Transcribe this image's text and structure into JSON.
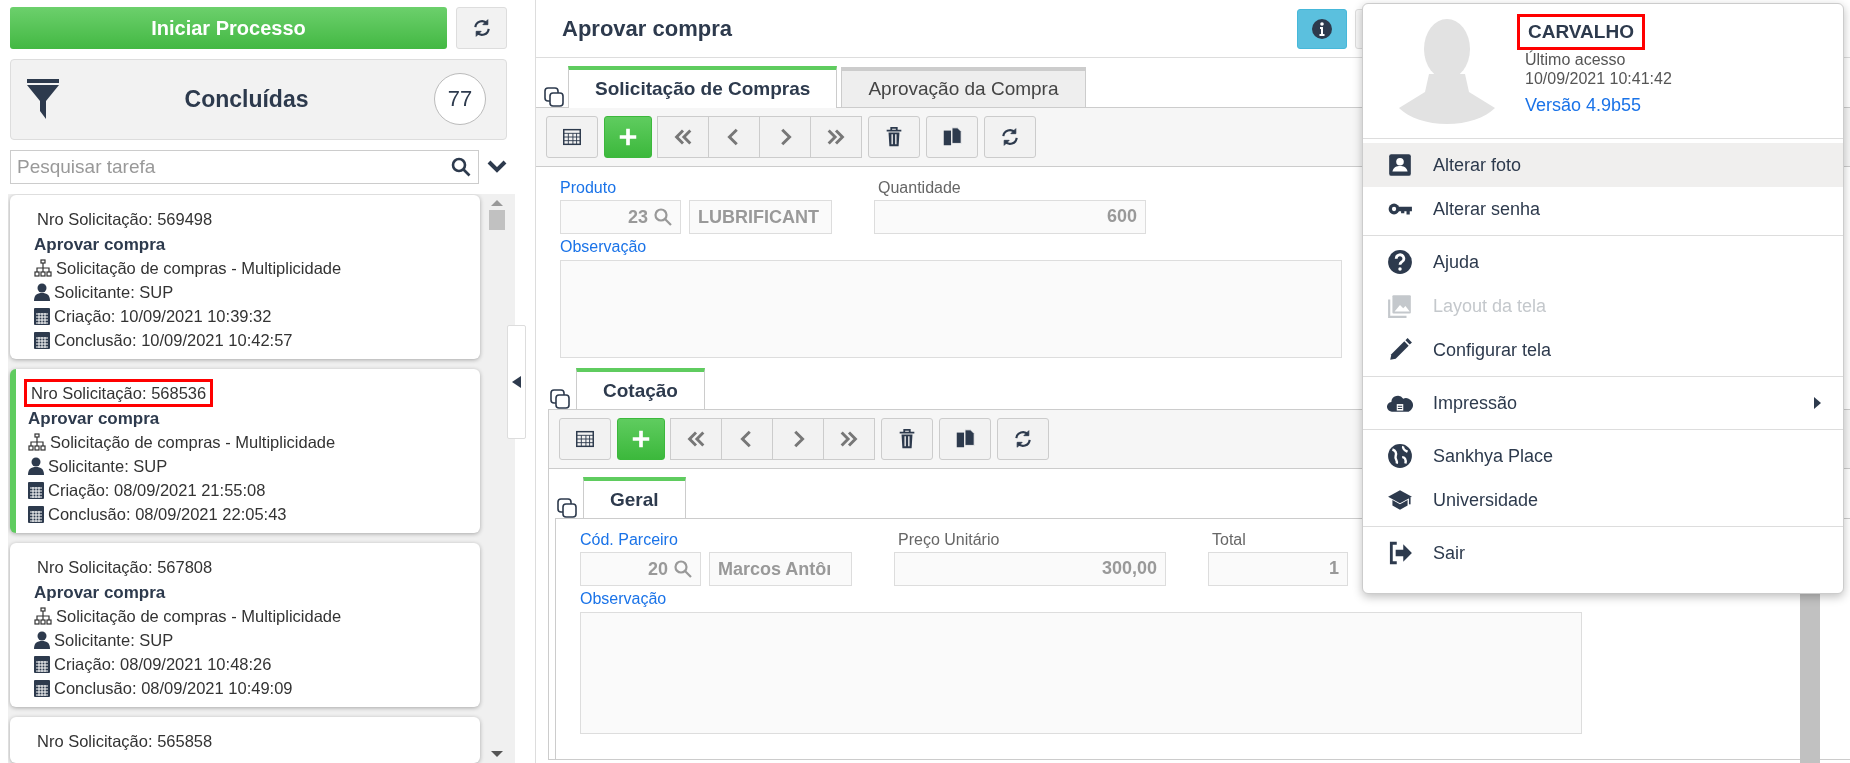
{
  "sidebar": {
    "start_button": "Iniciar Processo",
    "filter": {
      "label": "Concluídas",
      "count": "77"
    },
    "search": {
      "placeholder": "Pesquisar tarefa"
    },
    "tasks": [
      {
        "number": "Nro Solicitação: 569498",
        "title": "Aprovar compra",
        "process": "Solicitação de compras - Multiplicidade",
        "requester": "Solicitante:  SUP",
        "created": "Criação: 10/09/2021 10:39:32",
        "completed": "Conclusão: 10/09/2021 10:42:57",
        "selected": false,
        "highlighted": false
      },
      {
        "number": "Nro Solicitação: 568536",
        "title": "Aprovar compra",
        "process": "Solicitação de compras - Multiplicidade",
        "requester": "Solicitante:  SUP",
        "created": "Criação: 08/09/2021 21:55:08",
        "completed": "Conclusão: 08/09/2021 22:05:43",
        "selected": true,
        "highlighted": true
      },
      {
        "number": "Nro Solicitação: 567808",
        "title": "Aprovar compra",
        "process": "Solicitação de compras - Multiplicidade",
        "requester": "Solicitante:  SUP",
        "created": "Criação: 08/09/2021 10:48:26",
        "completed": "Conclusão: 08/09/2021 10:49:09",
        "selected": false,
        "highlighted": false
      },
      {
        "number": "Nro Solicitação: 565858",
        "selected": false,
        "highlighted": false
      }
    ]
  },
  "main": {
    "title": "Aprovar compra",
    "tabs": [
      {
        "label": "Solicitação de Compras",
        "selected": true
      },
      {
        "label": "Aprovação da Compra",
        "selected": false
      }
    ],
    "fields": [
      {
        "kind": "lookup",
        "label": "Produto",
        "required": true,
        "code": "23",
        "value": "LUBRIFICANT"
      },
      {
        "kind": "number",
        "label": "Quantidade",
        "required": false,
        "value": "600"
      }
    ],
    "notes_label": "Observação",
    "detail": {
      "tabs": [
        {
          "label": "Cotação",
          "selected": true
        }
      ],
      "inner_tabs": [
        {
          "label": "Geral",
          "selected": true
        }
      ],
      "fields": [
        {
          "kind": "lookup",
          "label": "Cód. Parceiro",
          "required": true,
          "code": "20",
          "value": "Marcos Antôı"
        },
        {
          "kind": "number",
          "label": "Preço Unitário",
          "required": false,
          "value": "300,00"
        },
        {
          "kind": "number",
          "label": "Total",
          "required": false,
          "value": "1"
        }
      ],
      "notes_label": "Observação"
    }
  },
  "user_menu": {
    "name": "CARVALHO",
    "name_highlighted": true,
    "last_access_label": "Último acesso",
    "last_access": "10/09/2021 10:41:42",
    "version": "Versão 4.9b55",
    "groups": [
      [
        {
          "kind": "portrait",
          "label": "Alterar foto",
          "selected": true,
          "disabled": false,
          "submenu": false
        },
        {
          "kind": "key",
          "label": "Alterar senha",
          "selected": false,
          "disabled": false,
          "submenu": false
        }
      ],
      [
        {
          "kind": "help",
          "label": "Ajuda",
          "selected": false,
          "disabled": false,
          "submenu": false
        },
        {
          "kind": "images",
          "label": "Layout da tela",
          "selected": false,
          "disabled": true,
          "submenu": false
        },
        {
          "kind": "pencil",
          "label": "Configurar tela",
          "selected": false,
          "disabled": false,
          "submenu": false
        }
      ],
      [
        {
          "kind": "cloud",
          "label": "Impressão",
          "selected": false,
          "disabled": false,
          "submenu": true
        }
      ],
      [
        {
          "kind": "globe",
          "label": "Sankhya Place",
          "selected": false,
          "disabled": false,
          "submenu": false
        },
        {
          "kind": "cap",
          "label": "Universidade",
          "selected": false,
          "disabled": false,
          "submenu": false
        }
      ],
      [
        {
          "kind": "exit",
          "label": "Sair",
          "selected": false,
          "disabled": false,
          "submenu": false
        }
      ]
    ]
  }
}
